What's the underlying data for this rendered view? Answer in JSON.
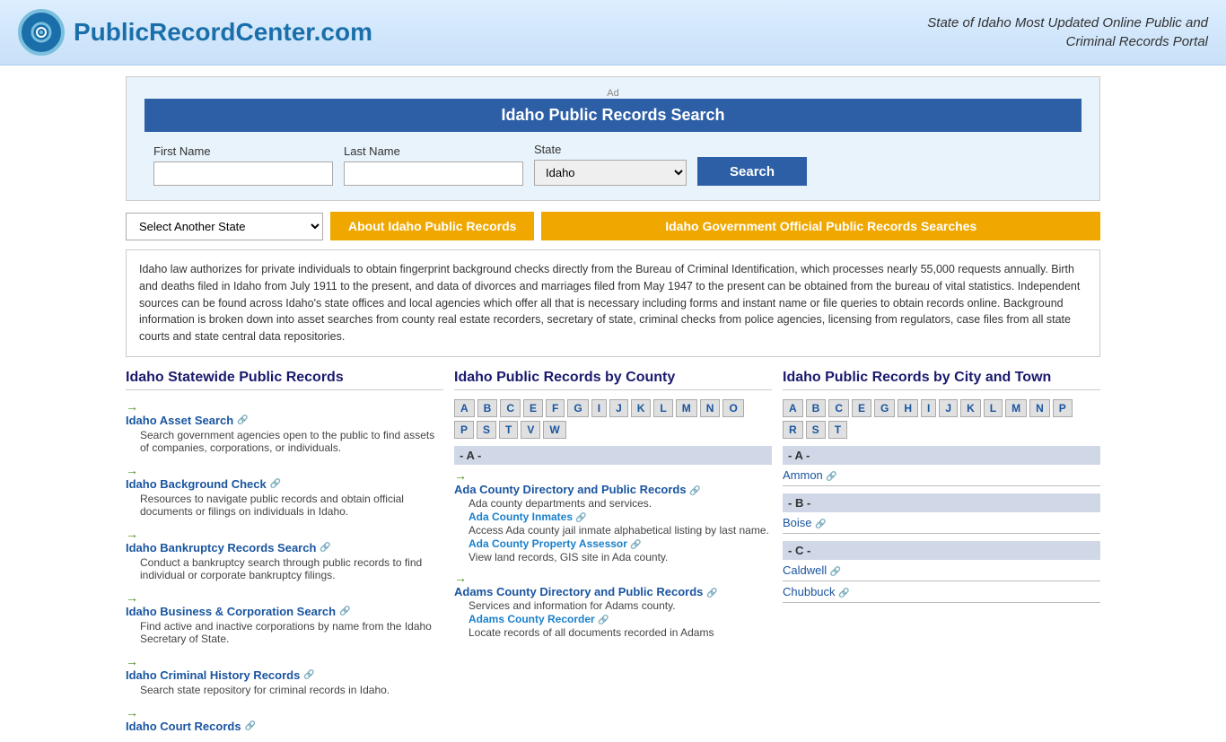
{
  "header": {
    "site_name": "PublicRecordCenter.com",
    "tagline": "State of Idaho Most Updated Online Public and\nCriminal Records Portal"
  },
  "search_box": {
    "ad_label": "Ad",
    "title": "Idaho Public Records Search",
    "first_name_label": "First Name",
    "last_name_label": "Last Name",
    "state_label": "State",
    "state_value": "Idaho",
    "search_button": "Search"
  },
  "nav": {
    "select_state_placeholder": "Select Another State",
    "about_button": "About Idaho Public Records",
    "gov_button": "Idaho Government Official Public Records Searches"
  },
  "info_text": "Idaho law authorizes for private individuals to obtain fingerprint background checks directly from the Bureau of Criminal Identification, which processes nearly 55,000 requests annually. Birth and deaths filed in Idaho from July 1911 to the present, and data of divorces and marriages filed from May 1947 to the present can be obtained from the bureau of vital statistics. Independent sources can be found across Idaho's state offices and local agencies which offer all that is necessary including forms and instant name or file queries to obtain records online. Background information is broken down into asset searches from county real estate recorders, secretary of state, criminal checks from police agencies, licensing from regulators, case files from all state courts and state central data repositories.",
  "statewide": {
    "title": "Idaho Statewide Public Records",
    "items": [
      {
        "label": "Idaho Asset Search",
        "desc": "Search government agencies open to the public to find assets of companies, corporations, or individuals."
      },
      {
        "label": "Idaho Background Check",
        "desc": "Resources to navigate public records and obtain official documents or filings on individuals in Idaho."
      },
      {
        "label": "Idaho Bankruptcy Records Search",
        "desc": "Conduct a bankruptcy search through public records to find individual or corporate bankruptcy filings."
      },
      {
        "label": "Idaho Business & Corporation Search",
        "desc": "Find active and inactive corporations by name from the Idaho Secretary of State."
      },
      {
        "label": "Idaho Criminal History Records",
        "desc": "Search state repository for criminal records in Idaho."
      },
      {
        "label": "Idaho Court Records",
        "desc": ""
      }
    ]
  },
  "county": {
    "title": "Idaho Public Records by County",
    "alpha_row1": [
      "A",
      "B",
      "C",
      "E",
      "F",
      "G",
      "I",
      "J",
      "K",
      "L",
      "M",
      "N",
      "O"
    ],
    "alpha_row2": [
      "P",
      "S",
      "T",
      "V",
      "W"
    ],
    "sections": [
      {
        "letter": "- A -",
        "entries": [
          {
            "main_link": "Ada County Directory and Public Records",
            "main_desc": "Ada county departments and services.",
            "sub_links": [
              {
                "label": "Ada County Inmates",
                "desc": "Access Ada county jail inmate alphabetical listing by last name."
              },
              {
                "label": "Ada County Property Assessor",
                "desc": "View land records, GIS site in Ada county."
              }
            ]
          },
          {
            "main_link": "Adams County Directory and Public Records",
            "main_desc": "Services and information for Adams county.",
            "sub_links": [
              {
                "label": "Adams County Recorder",
                "desc": "Locate records of all documents recorded in Adams"
              }
            ]
          }
        ]
      }
    ]
  },
  "city": {
    "title": "Idaho Public Records by City and Town",
    "alpha_row1": [
      "A",
      "B",
      "C",
      "E",
      "G",
      "H",
      "I",
      "J",
      "K",
      "L",
      "M",
      "N",
      "P"
    ],
    "alpha_row2": [
      "R",
      "S",
      "T"
    ],
    "sections": [
      {
        "letter": "- A -",
        "cities": [
          "Ammon"
        ]
      },
      {
        "letter": "- B -",
        "cities": [
          "Boise"
        ]
      },
      {
        "letter": "- C -",
        "cities": [
          "Caldwell",
          "Chubbuck"
        ]
      }
    ]
  }
}
